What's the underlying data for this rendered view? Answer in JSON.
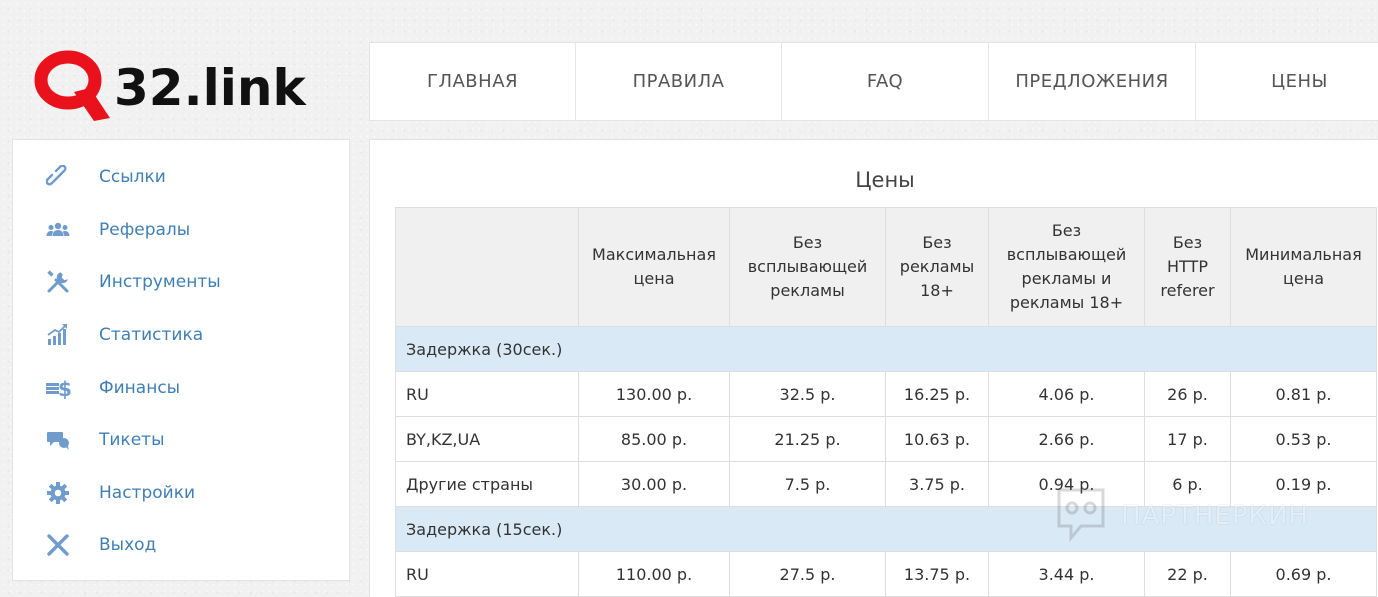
{
  "logo": {
    "letter": "Q",
    "text": "32.link",
    "brand_color": "#e8111c"
  },
  "topnav": {
    "items": [
      {
        "label": "ГЛАВНАЯ"
      },
      {
        "label": "ПРАВИЛА"
      },
      {
        "label": "FAQ"
      },
      {
        "label": "ПРЕДЛОЖЕНИЯ"
      },
      {
        "label": "ЦЕНЫ"
      }
    ]
  },
  "sidebar": {
    "link_color": "#3f7fb3",
    "items": [
      {
        "label": "Ссылки",
        "icon": "link-icon"
      },
      {
        "label": "Рефералы",
        "icon": "users-icon"
      },
      {
        "label": "Инструменты",
        "icon": "tools-icon"
      },
      {
        "label": "Статистика",
        "icon": "chart-icon"
      },
      {
        "label": "Финансы",
        "icon": "finance-icon"
      },
      {
        "label": "Тикеты",
        "icon": "tickets-icon"
      },
      {
        "label": "Настройки",
        "icon": "gear-icon"
      },
      {
        "label": "Выход",
        "icon": "close-icon"
      }
    ]
  },
  "main": {
    "title": "Цены",
    "table": {
      "headers": [
        "",
        "Максимальная цена",
        "Без всплывающей рекламы",
        "Без рекламы 18+",
        "Без всплывающей рекламы и рекламы 18+",
        "Без HTTP referer",
        "Минимальная цена"
      ],
      "groups": [
        {
          "title": "Задержка (30сек.)",
          "rows": [
            [
              "RU",
              "130.00 р.",
              "32.5 р.",
              "16.25 р.",
              "4.06 р.",
              "26 р.",
              "0.81 р."
            ],
            [
              "BY,KZ,UA",
              "85.00 р.",
              "21.25 р.",
              "10.63 р.",
              "2.66 р.",
              "17 р.",
              "0.53 р."
            ],
            [
              "Другие страны",
              "30.00 р.",
              "7.5 р.",
              "3.75 р.",
              "0.94 р.",
              "6 р.",
              "0.19 р."
            ]
          ]
        },
        {
          "title": "Задержка (15сек.)",
          "rows": [
            [
              "RU",
              "110.00 р.",
              "27.5 р.",
              "13.75 р.",
              "3.44 р.",
              "22 р.",
              "0.69 р."
            ]
          ]
        }
      ],
      "group_row_color": "#d9eaf6",
      "header_bg_color": "#f0f0f0"
    }
  },
  "watermark": {
    "text": "ПАРТНЕРКИН"
  }
}
